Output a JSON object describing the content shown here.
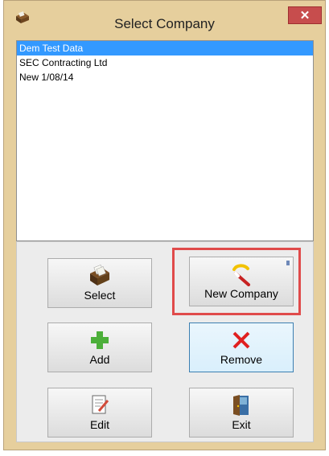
{
  "window": {
    "title": "Select Company",
    "close_glyph": "✕"
  },
  "companies": [
    {
      "label": "Dem Test Data",
      "selected": true
    },
    {
      "label": "SEC Contracting Ltd",
      "selected": false
    },
    {
      "label": "New 1/08/14",
      "selected": false
    }
  ],
  "buttons": {
    "select": {
      "label": "Select",
      "icon": "card-file-icon"
    },
    "new_company": {
      "label": "New Company",
      "icon": "magic-wand-icon"
    },
    "add": {
      "label": "Add",
      "icon": "plus-icon"
    },
    "remove": {
      "label": "Remove",
      "icon": "red-x-icon"
    },
    "edit": {
      "label": "Edit",
      "icon": "edit-document-icon"
    },
    "exit": {
      "label": "Exit",
      "icon": "door-exit-icon"
    }
  },
  "colors": {
    "selection": "#3399ff",
    "highlight_box": "#e04b4b",
    "close_button": "#c74d4d",
    "add_icon": "#4caf3a",
    "remove_icon": "#e02020"
  }
}
